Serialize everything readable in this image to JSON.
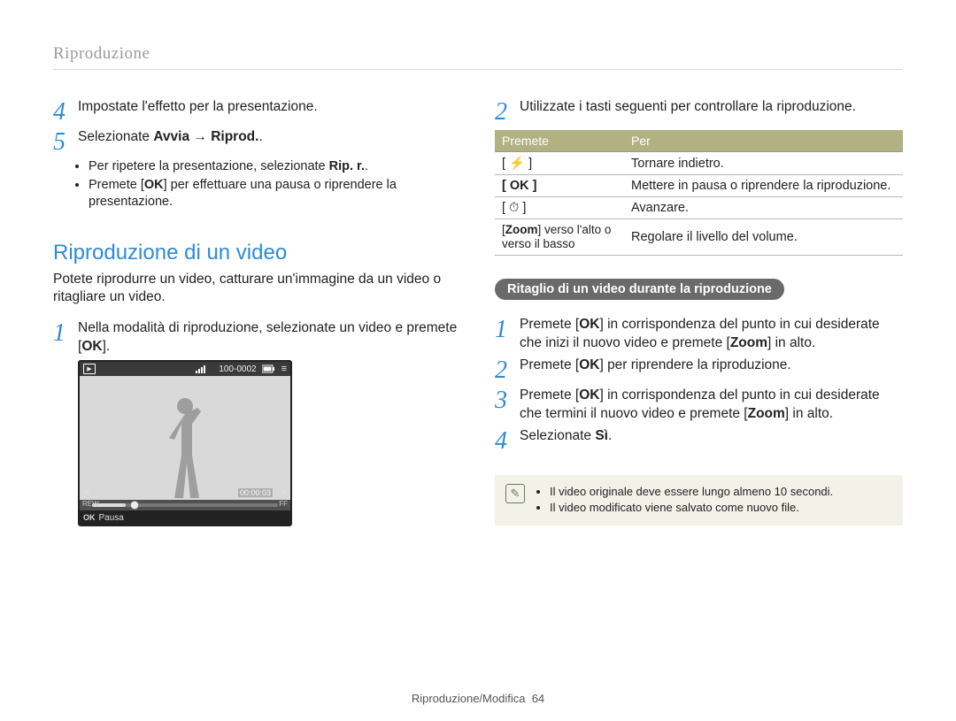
{
  "header": {
    "title": "Riproduzione"
  },
  "left": {
    "step4": {
      "num": "4",
      "text": "Impostate l'effetto per la presentazione."
    },
    "step5": {
      "num": "5",
      "prefix": "Selezionate ",
      "bold": "Avvia → Riprod.",
      "suffix": ".",
      "bullets": [
        {
          "pre": "Per ripetere la presentazione, selezionate ",
          "bold": "Rip. r.",
          "post": "."
        },
        {
          "pre": "Premete [",
          "bold": "OK",
          "post": "] per effettuare una pausa o riprendere la presentazione."
        }
      ]
    },
    "h2": "Riproduzione di un video",
    "intro": "Potete riprodurre un video, catturare un'immagine da un video o ritagliare un video.",
    "step1": {
      "num": "1",
      "pre": "Nella modalità di riproduzione, selezionate un video e premete [",
      "bold": "OK",
      "post": "]."
    },
    "device": {
      "counter": "100-0002",
      "time": "00:00:03",
      "rew": "REW",
      "ff": "FF",
      "ok": "OK",
      "pausa": "Pausa"
    }
  },
  "right": {
    "step2top": {
      "num": "2",
      "text": "Utilizzate i tasti seguenti per controllare la riproduzione."
    },
    "table": {
      "head1": "Premete",
      "head2": "Per",
      "rows": [
        {
          "k": "[ ⚡ ]",
          "d": "Tornare indietro."
        },
        {
          "k": "[ OK ]",
          "d": "Mettere in pausa o riprendere la riproduzione."
        },
        {
          "k": "[ ⏱ ]",
          "d": "Avanzare."
        },
        {
          "k_pre": "[",
          "k_bold": "Zoom",
          "k_post": "] verso l'alto o verso il basso",
          "d": "Regolare il livello del volume."
        }
      ]
    },
    "pill": "Ritaglio di un video durante la riproduzione",
    "s1": {
      "num": "1",
      "pre": "Premete [",
      "ok": "OK",
      "mid": "] in corrispondenza del punto in cui desiderate che inizi il nuovo video e premete [",
      "zoom": "Zoom",
      "post": "] in alto."
    },
    "s2": {
      "num": "2",
      "pre": "Premete [",
      "ok": "OK",
      "post": "] per riprendere la riproduzione."
    },
    "s3": {
      "num": "3",
      "pre": "Premete [",
      "ok": "OK",
      "mid": "] in corrispondenza del punto in cui desiderate che termini il nuovo video e premete [",
      "zoom": "Zoom",
      "post": "] in alto."
    },
    "s4": {
      "num": "4",
      "pre": "Selezionate ",
      "bold": "Sì",
      "post": "."
    },
    "note": {
      "b1": "Il video originale deve essere lungo almeno 10 secondi.",
      "b2": "Il video modificato viene salvato come nuovo file."
    }
  },
  "footer": {
    "section": "Riproduzione/Modifica",
    "page": "64"
  }
}
